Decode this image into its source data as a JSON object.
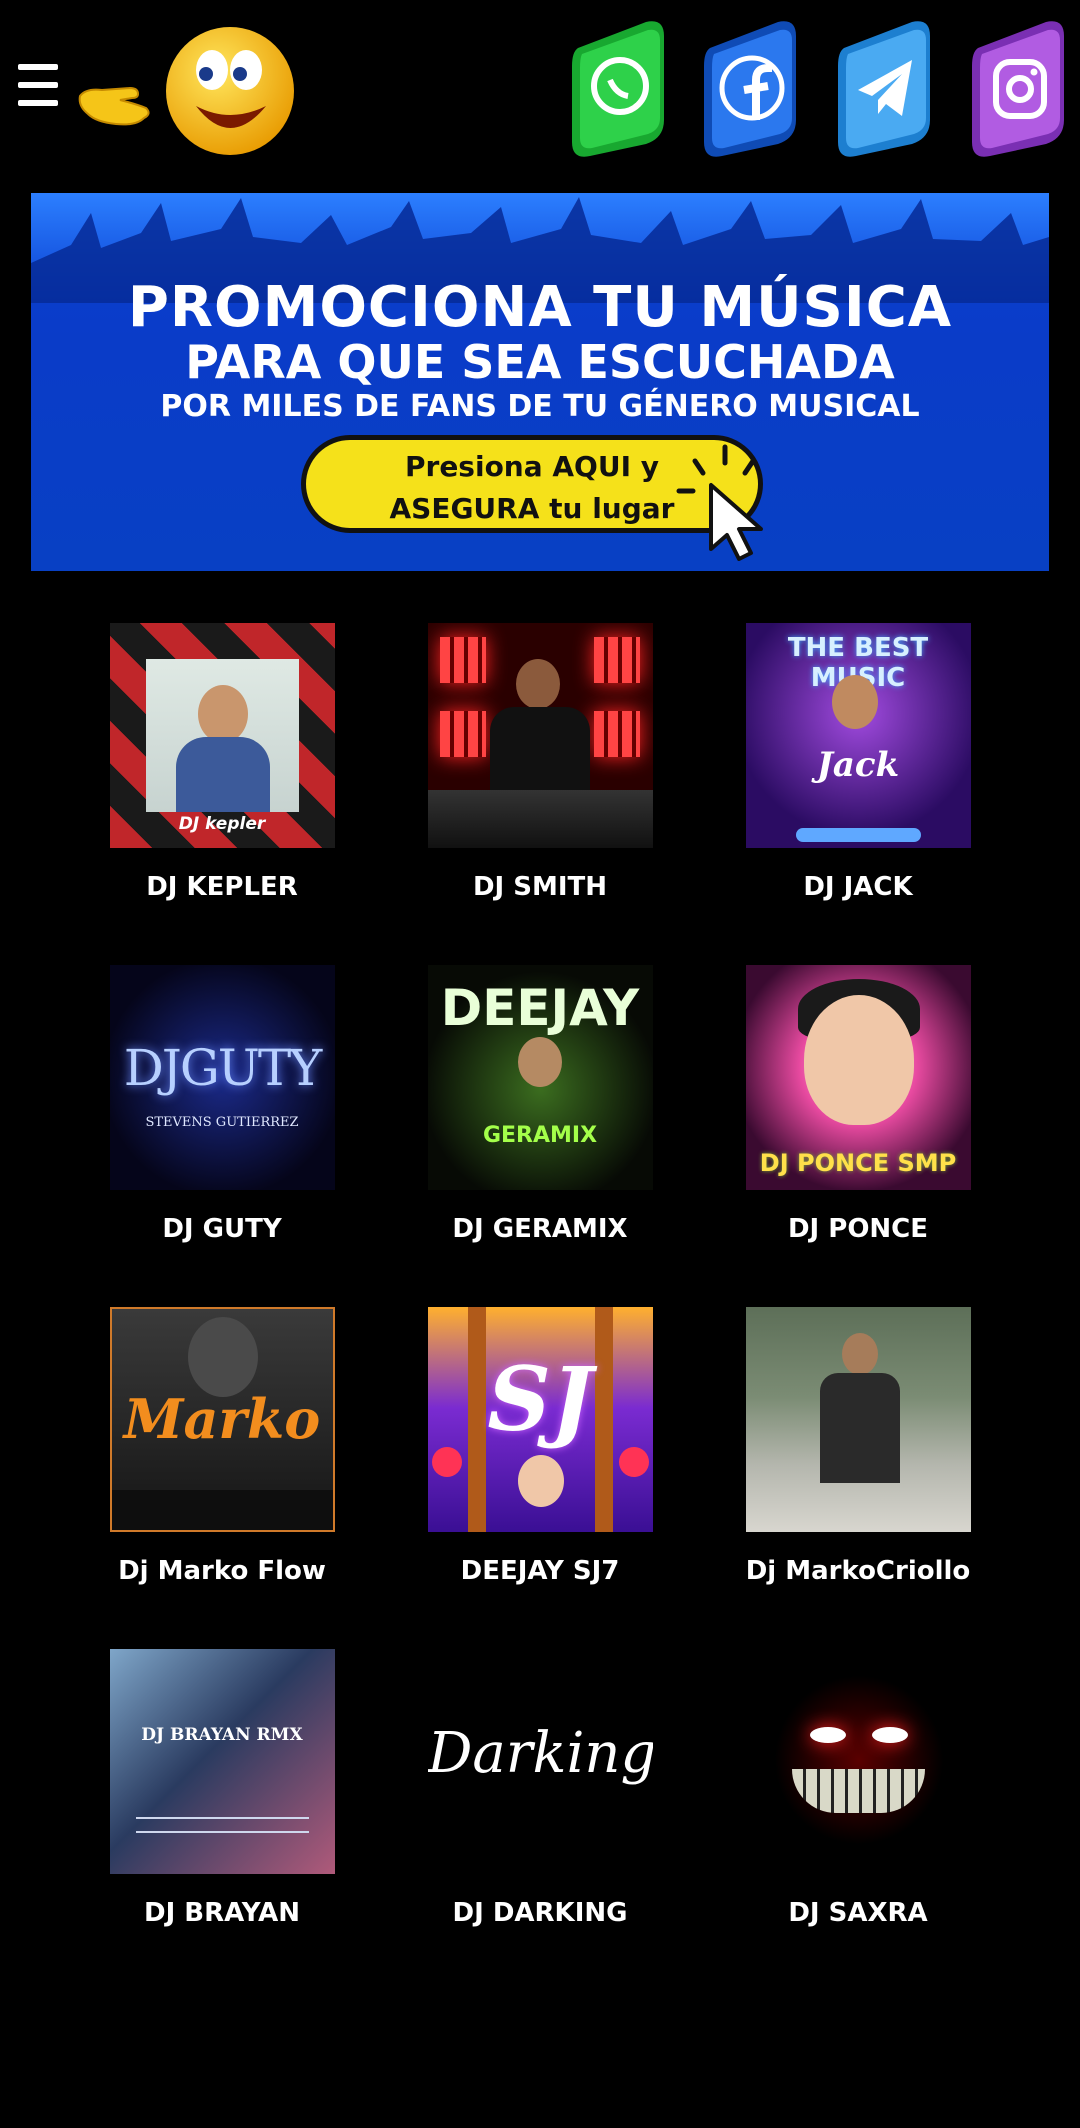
{
  "header": {
    "menu_icon": "hamburger-icon",
    "hand_icon": "pointing-hand-icon",
    "smiley_icon": "smiley-face-icon",
    "social": [
      {
        "id": "whatsapp",
        "icon": "whatsapp-icon",
        "color": "#25c23a"
      },
      {
        "id": "facebook",
        "icon": "facebook-icon",
        "color": "#1c66e6"
      },
      {
        "id": "telegram",
        "icon": "telegram-icon",
        "color": "#2b9ff0"
      },
      {
        "id": "instagram",
        "icon": "instagram-icon",
        "color": "#a64ad8"
      }
    ]
  },
  "banner": {
    "line1": "PROMOCIONA TU MÚSICA",
    "line2": "PARA QUE SEA ESCUCHADA",
    "line3": "POR MILES DE FANS DE TU GÉNERO MUSICAL",
    "cta_line1": "Presiona AQUI y",
    "cta_line2": "ASEGURA tu lugar",
    "background": "#0a3fd0",
    "cta_color": "#f5e11a"
  },
  "djs": [
    {
      "name": "DJ KEPLER",
      "thumb_text": "DJ kepler"
    },
    {
      "name": "DJ SMITH"
    },
    {
      "name": "DJ JACK",
      "thumb_text": "THE BEST MUSIC",
      "thumb_sub": "Jack"
    },
    {
      "name": "DJ GUTY",
      "thumb_text": "DJGUTY",
      "thumb_sub": "STEVENS GUTIERREZ"
    },
    {
      "name": "DJ GERAMIX",
      "thumb_text": "DEEJAY",
      "thumb_sub": "GERAMIX"
    },
    {
      "name": "DJ PONCE",
      "thumb_text": "DJ PONCE SMP"
    },
    {
      "name": "Dj Marko Flow",
      "thumb_text": "Marko"
    },
    {
      "name": "DEEJAY SJ7",
      "thumb_text": "SJ"
    },
    {
      "name": "Dj MarkoCriollo"
    },
    {
      "name": "DJ BRAYAN",
      "thumb_text": "DJ BRAYAN RMX"
    },
    {
      "name": "DJ DARKING",
      "thumb_text": "Darking"
    },
    {
      "name": "DJ SAXRA"
    }
  ]
}
